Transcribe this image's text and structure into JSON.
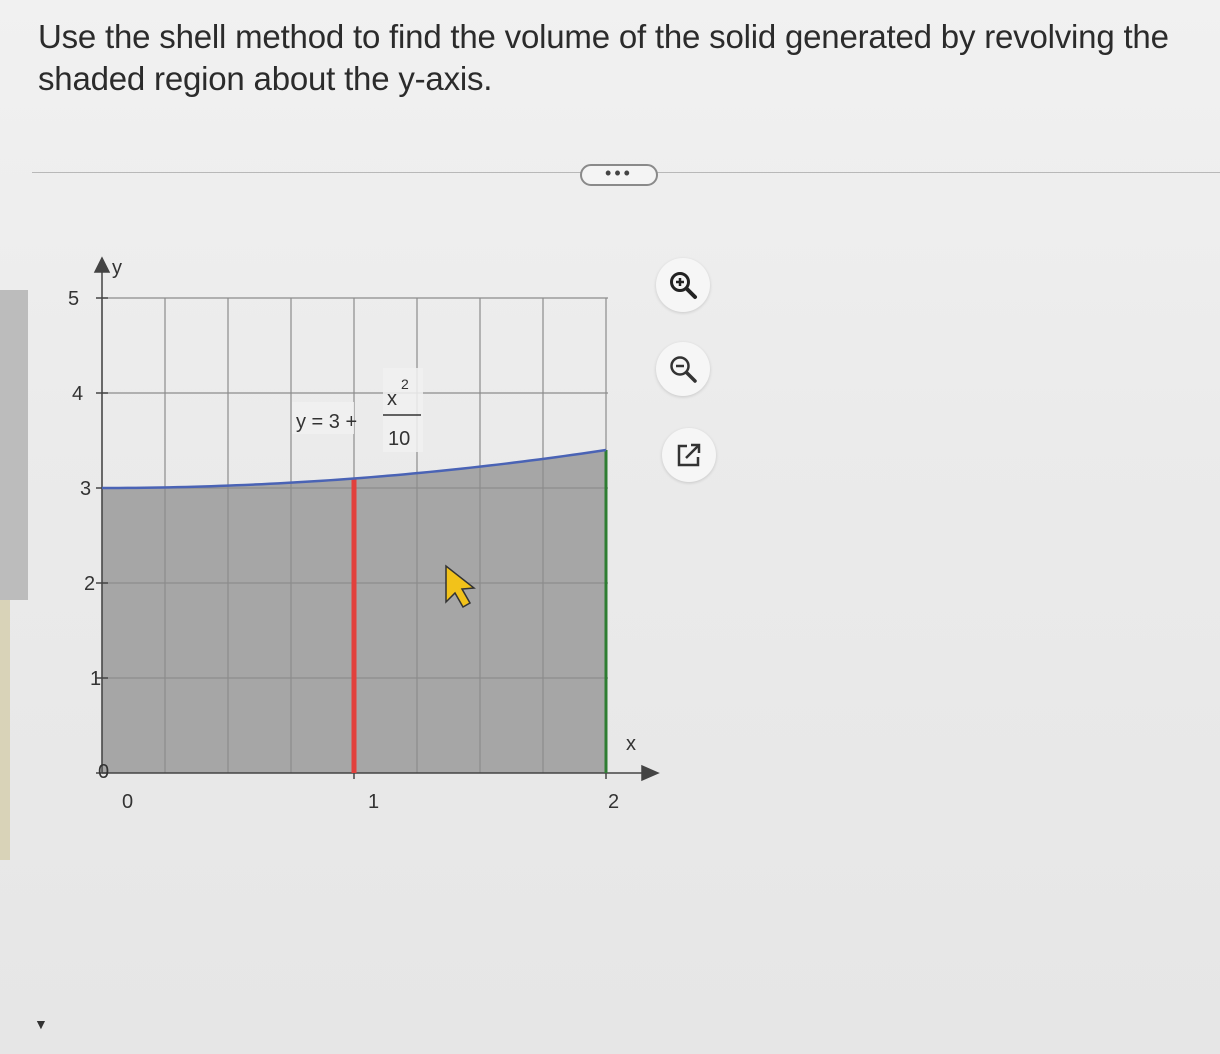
{
  "question": {
    "text": "Use the shell method to find the volume of the solid generated by revolving the shaded region about the y-axis."
  },
  "more_button": {
    "label": "•••"
  },
  "graph": {
    "y_axis_label": "y",
    "x_axis_label": "x",
    "y_ticks": [
      "0",
      "1",
      "2",
      "3",
      "4",
      "5"
    ],
    "x_ticks": [
      "0",
      "1",
      "2"
    ],
    "curve_label": {
      "lhs": "y = 3 +",
      "numerator": "x",
      "exponent": "2",
      "denominator": "10"
    },
    "colors": {
      "shade": "#a6a6a6",
      "curve": "#4a63b5",
      "strip": "#e2403c",
      "right_edge": "#2e7d32",
      "grid": "#8c8c8c",
      "cursor": "#f2c21a"
    }
  },
  "tools": {
    "zoom_in": "zoom-in-icon",
    "zoom_out": "zoom-out-icon",
    "popout": "external-link-icon"
  }
}
